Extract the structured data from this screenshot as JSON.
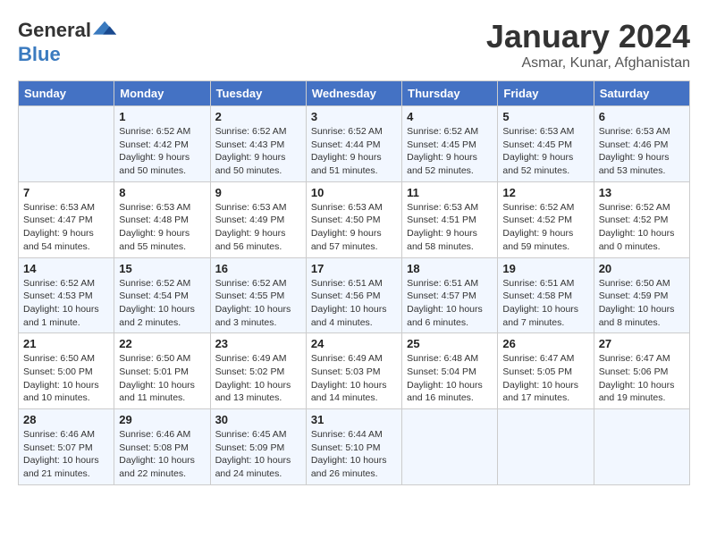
{
  "logo": {
    "general": "General",
    "blue": "Blue"
  },
  "title": "January 2024",
  "subtitle": "Asmar, Kunar, Afghanistan",
  "weekdays": [
    "Sunday",
    "Monday",
    "Tuesday",
    "Wednesday",
    "Thursday",
    "Friday",
    "Saturday"
  ],
  "weeks": [
    [
      {
        "day": null,
        "sunrise": null,
        "sunset": null,
        "daylight": null
      },
      {
        "day": "1",
        "sunrise": "Sunrise: 6:52 AM",
        "sunset": "Sunset: 4:42 PM",
        "daylight": "Daylight: 9 hours and 50 minutes."
      },
      {
        "day": "2",
        "sunrise": "Sunrise: 6:52 AM",
        "sunset": "Sunset: 4:43 PM",
        "daylight": "Daylight: 9 hours and 50 minutes."
      },
      {
        "day": "3",
        "sunrise": "Sunrise: 6:52 AM",
        "sunset": "Sunset: 4:44 PM",
        "daylight": "Daylight: 9 hours and 51 minutes."
      },
      {
        "day": "4",
        "sunrise": "Sunrise: 6:52 AM",
        "sunset": "Sunset: 4:45 PM",
        "daylight": "Daylight: 9 hours and 52 minutes."
      },
      {
        "day": "5",
        "sunrise": "Sunrise: 6:53 AM",
        "sunset": "Sunset: 4:45 PM",
        "daylight": "Daylight: 9 hours and 52 minutes."
      },
      {
        "day": "6",
        "sunrise": "Sunrise: 6:53 AM",
        "sunset": "Sunset: 4:46 PM",
        "daylight": "Daylight: 9 hours and 53 minutes."
      }
    ],
    [
      {
        "day": "7",
        "sunrise": "Sunrise: 6:53 AM",
        "sunset": "Sunset: 4:47 PM",
        "daylight": "Daylight: 9 hours and 54 minutes."
      },
      {
        "day": "8",
        "sunrise": "Sunrise: 6:53 AM",
        "sunset": "Sunset: 4:48 PM",
        "daylight": "Daylight: 9 hours and 55 minutes."
      },
      {
        "day": "9",
        "sunrise": "Sunrise: 6:53 AM",
        "sunset": "Sunset: 4:49 PM",
        "daylight": "Daylight: 9 hours and 56 minutes."
      },
      {
        "day": "10",
        "sunrise": "Sunrise: 6:53 AM",
        "sunset": "Sunset: 4:50 PM",
        "daylight": "Daylight: 9 hours and 57 minutes."
      },
      {
        "day": "11",
        "sunrise": "Sunrise: 6:53 AM",
        "sunset": "Sunset: 4:51 PM",
        "daylight": "Daylight: 9 hours and 58 minutes."
      },
      {
        "day": "12",
        "sunrise": "Sunrise: 6:52 AM",
        "sunset": "Sunset: 4:52 PM",
        "daylight": "Daylight: 9 hours and 59 minutes."
      },
      {
        "day": "13",
        "sunrise": "Sunrise: 6:52 AM",
        "sunset": "Sunset: 4:52 PM",
        "daylight": "Daylight: 10 hours and 0 minutes."
      }
    ],
    [
      {
        "day": "14",
        "sunrise": "Sunrise: 6:52 AM",
        "sunset": "Sunset: 4:53 PM",
        "daylight": "Daylight: 10 hours and 1 minute."
      },
      {
        "day": "15",
        "sunrise": "Sunrise: 6:52 AM",
        "sunset": "Sunset: 4:54 PM",
        "daylight": "Daylight: 10 hours and 2 minutes."
      },
      {
        "day": "16",
        "sunrise": "Sunrise: 6:52 AM",
        "sunset": "Sunset: 4:55 PM",
        "daylight": "Daylight: 10 hours and 3 minutes."
      },
      {
        "day": "17",
        "sunrise": "Sunrise: 6:51 AM",
        "sunset": "Sunset: 4:56 PM",
        "daylight": "Daylight: 10 hours and 4 minutes."
      },
      {
        "day": "18",
        "sunrise": "Sunrise: 6:51 AM",
        "sunset": "Sunset: 4:57 PM",
        "daylight": "Daylight: 10 hours and 6 minutes."
      },
      {
        "day": "19",
        "sunrise": "Sunrise: 6:51 AM",
        "sunset": "Sunset: 4:58 PM",
        "daylight": "Daylight: 10 hours and 7 minutes."
      },
      {
        "day": "20",
        "sunrise": "Sunrise: 6:50 AM",
        "sunset": "Sunset: 4:59 PM",
        "daylight": "Daylight: 10 hours and 8 minutes."
      }
    ],
    [
      {
        "day": "21",
        "sunrise": "Sunrise: 6:50 AM",
        "sunset": "Sunset: 5:00 PM",
        "daylight": "Daylight: 10 hours and 10 minutes."
      },
      {
        "day": "22",
        "sunrise": "Sunrise: 6:50 AM",
        "sunset": "Sunset: 5:01 PM",
        "daylight": "Daylight: 10 hours and 11 minutes."
      },
      {
        "day": "23",
        "sunrise": "Sunrise: 6:49 AM",
        "sunset": "Sunset: 5:02 PM",
        "daylight": "Daylight: 10 hours and 13 minutes."
      },
      {
        "day": "24",
        "sunrise": "Sunrise: 6:49 AM",
        "sunset": "Sunset: 5:03 PM",
        "daylight": "Daylight: 10 hours and 14 minutes."
      },
      {
        "day": "25",
        "sunrise": "Sunrise: 6:48 AM",
        "sunset": "Sunset: 5:04 PM",
        "daylight": "Daylight: 10 hours and 16 minutes."
      },
      {
        "day": "26",
        "sunrise": "Sunrise: 6:47 AM",
        "sunset": "Sunset: 5:05 PM",
        "daylight": "Daylight: 10 hours and 17 minutes."
      },
      {
        "day": "27",
        "sunrise": "Sunrise: 6:47 AM",
        "sunset": "Sunset: 5:06 PM",
        "daylight": "Daylight: 10 hours and 19 minutes."
      }
    ],
    [
      {
        "day": "28",
        "sunrise": "Sunrise: 6:46 AM",
        "sunset": "Sunset: 5:07 PM",
        "daylight": "Daylight: 10 hours and 21 minutes."
      },
      {
        "day": "29",
        "sunrise": "Sunrise: 6:46 AM",
        "sunset": "Sunset: 5:08 PM",
        "daylight": "Daylight: 10 hours and 22 minutes."
      },
      {
        "day": "30",
        "sunrise": "Sunrise: 6:45 AM",
        "sunset": "Sunset: 5:09 PM",
        "daylight": "Daylight: 10 hours and 24 minutes."
      },
      {
        "day": "31",
        "sunrise": "Sunrise: 6:44 AM",
        "sunset": "Sunset: 5:10 PM",
        "daylight": "Daylight: 10 hours and 26 minutes."
      },
      {
        "day": null,
        "sunrise": null,
        "sunset": null,
        "daylight": null
      },
      {
        "day": null,
        "sunrise": null,
        "sunset": null,
        "daylight": null
      },
      {
        "day": null,
        "sunrise": null,
        "sunset": null,
        "daylight": null
      }
    ]
  ]
}
